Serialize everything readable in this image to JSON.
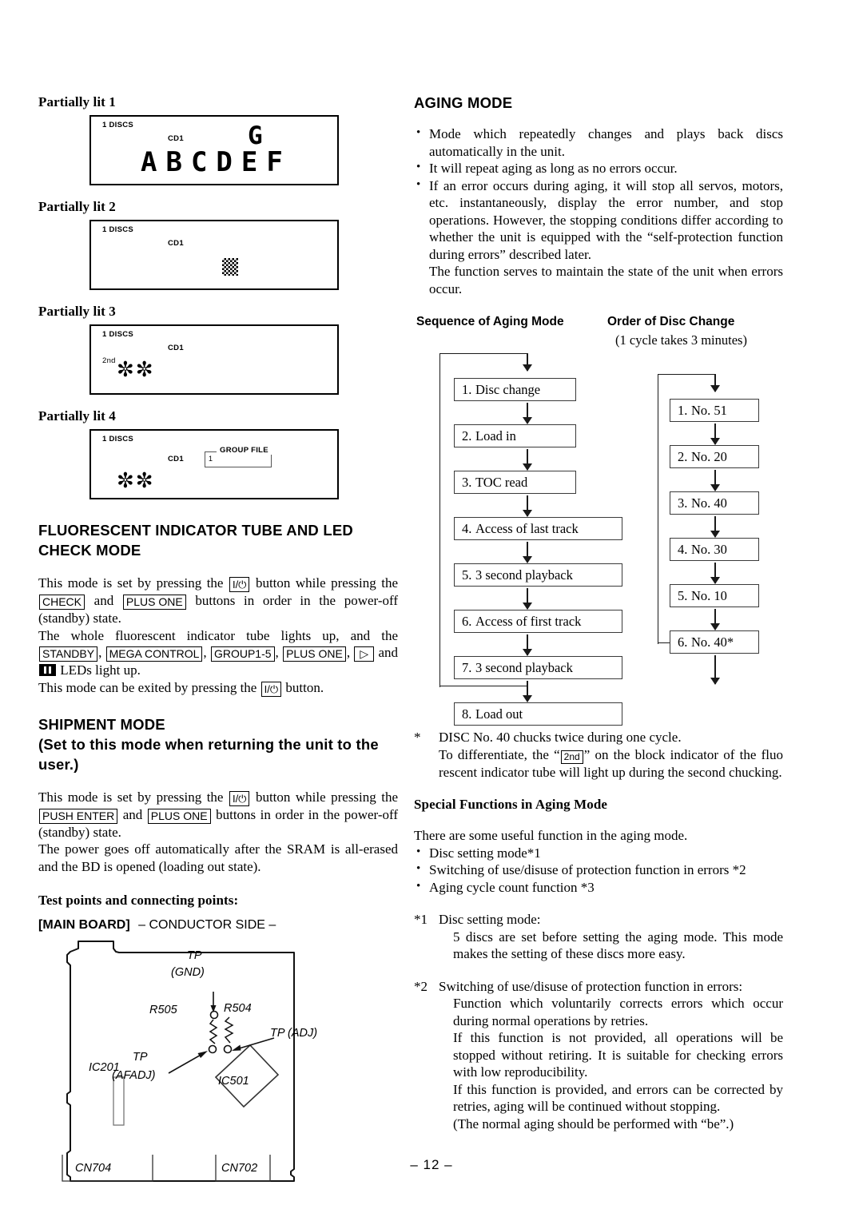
{
  "page": {
    "footer": "– 12 –"
  },
  "left": {
    "panels": [
      {
        "label": "Partially lit 1",
        "discs": "1 DISCS",
        "cd": "CD1",
        "block": "G",
        "segments": "ABCDEF"
      },
      {
        "label": "Partially lit 2",
        "discs": "1 DISCS",
        "cd": "CD1",
        "checker": "checkerboard-block"
      },
      {
        "label": "Partially lit 3",
        "discs": "1 DISCS",
        "cd": "CD1",
        "second": "2nd",
        "stars": "✼✼"
      },
      {
        "label": "Partially lit 4",
        "discs": "1 DISCS",
        "cd": "CD1",
        "stars": "✼✼",
        "group_file_title": "GROUP FILE",
        "group_file_num": "1"
      }
    ],
    "fl_section": {
      "heading_line1": "FLUORESCENT INDICATOR TUBE AND LED",
      "heading_line2": "CHECK MODE",
      "p1_a": "This mode is set by pressing the",
      "key_power": "I/⏻",
      "p1_b": "button while pressing the",
      "key_check": "CHECK",
      "p1_c": "and",
      "key_plus_one": "PLUS ONE",
      "p1_d": "buttons in order in the power-off (standby) state.",
      "p2_a": "The whole fluorescent indicator tube lights up, and the",
      "key_standby": "STANDBY",
      "key_mega_control": "MEGA CONTROL",
      "key_group15": "GROUP1-5",
      "key_plus_one2": "PLUS ONE",
      "key_play": "▷",
      "p2_b": "and",
      "p2_c": "LEDs light up.",
      "p3_a": "This mode can be exited by pressing the",
      "p3_b": "button."
    },
    "shipment": {
      "heading_line1": "SHIPMENT  MODE",
      "heading_line2": "(Set to this mode when returning the unit to the",
      "heading_line3": "user.)",
      "p1_a": "This mode is set by pressing the",
      "key_power": "I/⏻",
      "p1_b": "button while pressing the",
      "key_push_enter": "PUSH ENTER",
      "p1_c": "and",
      "key_plus_one": "PLUS ONE",
      "p1_d": "buttons  in order in the power-off (standby) state.",
      "p2": "The power goes off automatically after the SRAM is all-erased and the BD is opened (loading out state)."
    },
    "board": {
      "test_points_heading": "Test points and connecting points:",
      "board_title_bold": "[MAIN BOARD]",
      "board_title_rest": "– CONDUCTOR SIDE –",
      "labels": {
        "tp_gnd_1": "TP",
        "tp_gnd_2": "(GND)",
        "r505": "R505",
        "r504": "R504",
        "tp_adj": "TP (ADJ)",
        "tp_afadj_1": "TP",
        "tp_afadj_2": "(AFADJ)",
        "ic501": "IC501",
        "ic201": "IC201",
        "cn704": "CN704",
        "cn702": "CN702"
      }
    }
  },
  "right": {
    "aging_heading": "AGING MODE",
    "aging_bullets": [
      "Mode which repeatedly changes and plays back discs automatically in the unit.",
      "It will repeat aging as long as no errors occur.",
      "If an error occurs during aging, it will stop all servos, motors, etc. instantaneously, display the error number, and stop operations. However, the stopping conditions differ according to whether the unit is equipped with the “self-protection function during errors” described later."
    ],
    "aging_trailer": "The function serves to maintain the state of the unit when errors occur.",
    "sequence_heading": "Sequence of Aging Mode",
    "order_heading": "Order of Disc Change",
    "order_subtitle": "(1 cycle takes 3 minutes)",
    "sequence_steps": [
      {
        "num": "1.",
        "text": "Disc change"
      },
      {
        "num": "2.",
        "text": "Load in"
      },
      {
        "num": "3.",
        "text": "TOC read"
      },
      {
        "num": "4.",
        "text": "Access of last track"
      },
      {
        "num": "5.",
        "text": "3 second playback"
      },
      {
        "num": "6.",
        "text": "Access of first track"
      },
      {
        "num": "7.",
        "text": "3 second playback"
      },
      {
        "num": "8.",
        "text": "Load out"
      }
    ],
    "order_steps": [
      {
        "num": "1.",
        "text": "No. 51"
      },
      {
        "num": "2.",
        "text": "No. 20"
      },
      {
        "num": "3.",
        "text": "No. 40"
      },
      {
        "num": "4.",
        "text": "No. 30"
      },
      {
        "num": "5.",
        "text": "No. 10"
      },
      {
        "num": "6.",
        "text": "No. 40*"
      }
    ],
    "footnote_star": {
      "mark": "*",
      "line1": "DISC No. 40 chucks twice during one cycle.",
      "line2_a": "To differentiate,  the “",
      "key_2nd": "2nd",
      "line2_b": "” on the block indicator of the fluo rescent indicator tube will light up during the second chucking."
    },
    "special_heading": "Special Functions in Aging Mode",
    "special_intro": "There are some useful function in the aging mode.",
    "special_bullets": [
      "Disc setting mode*1",
      "Switching of use/disuse of protection function in errors *2",
      "Aging cycle count function *3"
    ],
    "note1": {
      "mark": "*1",
      "title": "Disc setting mode:",
      "body": "5 discs are set before setting the aging mode. This mode makes the setting of these discs more easy."
    },
    "note2": {
      "mark": "*2",
      "title": "Switching of use/disuse of protection function in errors:",
      "body1": "Function which voluntarily corrects errors which occur during normal operations by retries.",
      "body2": "If this function is not provided, all operations will be stopped without retiring. It is suitable for checking errors with low reproducibility.",
      "body3": "If this function is provided, and errors can be corrected by retries, aging will be continued without stopping.",
      "body4": "(The normal aging should be performed with “be”.)"
    }
  }
}
